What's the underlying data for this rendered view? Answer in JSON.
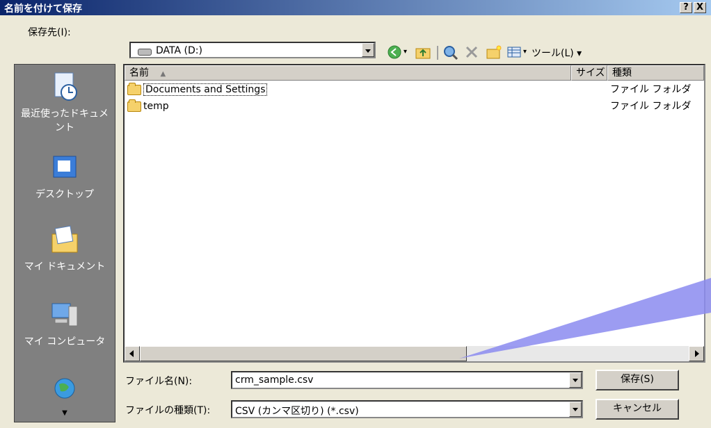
{
  "window": {
    "title": "名前を付けて保存",
    "help_label": "?",
    "close_label": "X"
  },
  "location": {
    "label": "保存先(I):",
    "value": "DATA (D:)"
  },
  "toolbar": {
    "tools_label": "ツール(L)"
  },
  "places": [
    {
      "label": "最近使ったドキュメント",
      "icon": "recent-documents-icon"
    },
    {
      "label": "デスクトップ",
      "icon": "desktop-icon"
    },
    {
      "label": "マイ ドキュメント",
      "icon": "my-documents-icon"
    },
    {
      "label": "マイ コンピュータ",
      "icon": "my-computer-icon"
    },
    {
      "label": "",
      "icon": "network-icon"
    }
  ],
  "columns": {
    "name": "名前",
    "size": "サイズ",
    "type": "種類"
  },
  "files": [
    {
      "name": "Documents and Settings",
      "type": "ファイル フォルダ"
    },
    {
      "name": "temp",
      "type": "ファイル フォルダ"
    }
  ],
  "filename": {
    "label": "ファイル名(N):",
    "value": "crm_sample.csv"
  },
  "filetype": {
    "label": "ファイルの種類(T):",
    "value": "CSV (カンマ区切り) (*.csv)"
  },
  "buttons": {
    "save": "保存(S)",
    "cancel": "キャンセル"
  }
}
